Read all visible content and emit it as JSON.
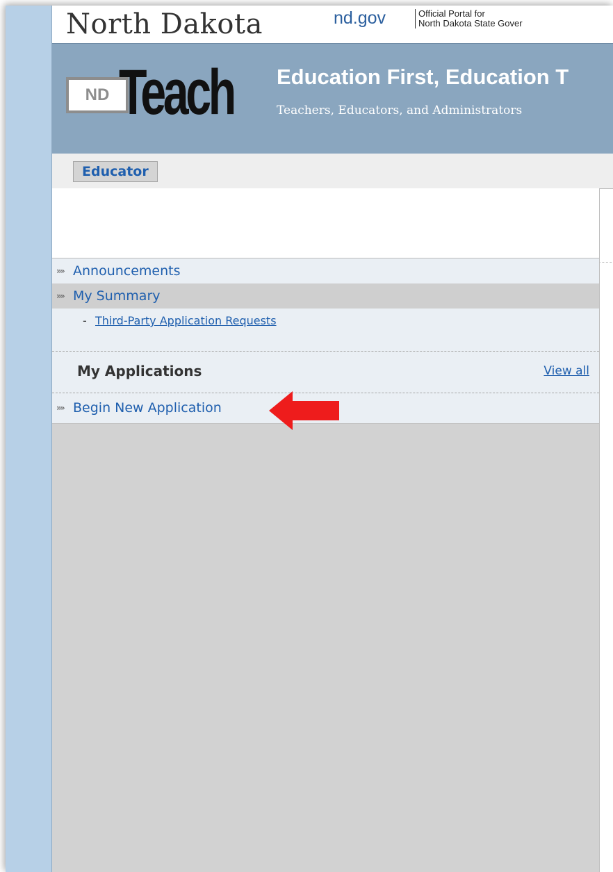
{
  "portal": {
    "state_name": "North Dakota",
    "ndgov": "nd.gov",
    "official_line1": "Official Portal for",
    "official_line2": "North Dakota State Gover"
  },
  "banner": {
    "logo_nd": "ND",
    "logo_teach": "Teach",
    "tagline": "Education First, Education T",
    "subtagline": "Teachers, Educators, and Administrators"
  },
  "role_tab": "Educator",
  "nav": {
    "announcements": "Announcements",
    "my_summary": "My Summary",
    "third_party_prefix": "-",
    "third_party": "Third-Party Application Requests",
    "my_applications": "My Applications",
    "view_all": "View all",
    "begin_new_application": "Begin New Application",
    "chevron": "»»"
  },
  "colors": {
    "link": "#1f5fae",
    "banner": "#8aa6bf",
    "arrow": "#ee1c1c"
  },
  "icons": {
    "pointer_arrow": "red-left-arrow-icon"
  }
}
